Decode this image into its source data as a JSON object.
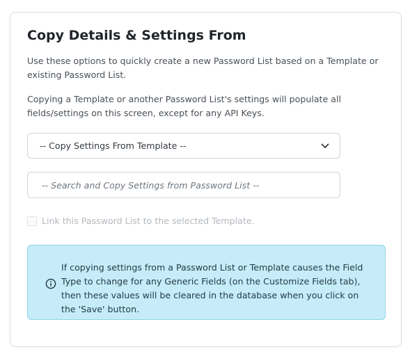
{
  "panel": {
    "title": "Copy Details & Settings From",
    "intro_text": "Use these options to quickly create a new Password List based on a Template or existing Password List.",
    "note_text": "Copying a Template or another Password List's settings will populate all fields/settings on this screen, except for any API Keys."
  },
  "template_select": {
    "selected_value": "-- Copy Settings From Template --",
    "icon": "chevron-down-icon"
  },
  "password_list_search": {
    "placeholder": "-- Search and Copy Settings from Password List --"
  },
  "link_checkbox": {
    "label": "Link this Password List to the selected Template.",
    "checked": false,
    "disabled": true
  },
  "info_alert": {
    "icon": "info-icon",
    "text": "If copying settings from a Password List or Template causes the Field Type to change for any Generic Fields (on the Customize Fields tab), then these values will be cleared in the database when you click on the 'Save' button.",
    "background_color": "#c6ecf9",
    "border_color": "#8fd3e6"
  }
}
